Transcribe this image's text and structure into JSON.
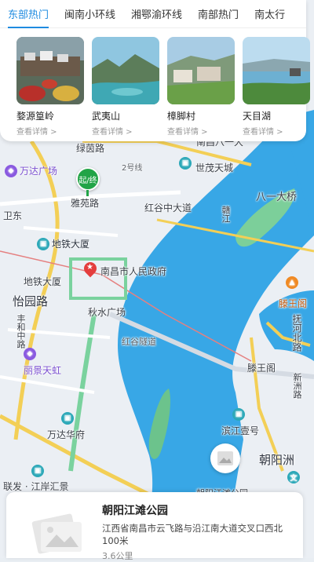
{
  "tabs": [
    {
      "label": "东部热门",
      "active": true
    },
    {
      "label": "闽南小环线",
      "active": false
    },
    {
      "label": "湘鄂渝环线",
      "active": false
    },
    {
      "label": "南部热门",
      "active": false
    },
    {
      "label": "南太行",
      "active": false
    }
  ],
  "cards": [
    {
      "name": "婺源篁岭",
      "more": "查看详情 >"
    },
    {
      "name": "武夷山",
      "more": "查看详情 >"
    },
    {
      "name": "樟脚村",
      "more": "查看详情 >"
    },
    {
      "name": "天目湖",
      "more": "查看详情 >"
    }
  ],
  "map": {
    "labels": {
      "lvyinlu": "绿茵路",
      "nanchangdaqiao": "南昌八一大",
      "line2": "2号线",
      "shimaotiancheng": "世茂天城",
      "bayidaqiao": "八一大桥",
      "wandaguangchang": "万达广场",
      "yaxilu": "雅苑路",
      "weidong": "卫东",
      "honggu": "红谷中大道",
      "ganjiang": "赣江",
      "ditiedasha1": "地铁大厦",
      "gov": "南昌市人民政府",
      "ditiedasha2": "地铁大厦",
      "tengwangge1": "滕王阁",
      "yiyuanlu": "怡园路",
      "qiushui": "秋水广场",
      "fuhebeilu": "抚河北路",
      "fengheluzhong": "丰和中路",
      "hongguzhudao": "红谷隧道",
      "lijingtianhong": "丽景天虹",
      "tengwangge2": "滕王阁",
      "xinzhoulu": "新洲路",
      "wandahuafu": "万达华府",
      "binjiang": "滨江壹号",
      "chaoyangzhou": "朝阳洲",
      "lianfa": "联发 · 江岸汇景",
      "chaoyangpark": "朝阳江滩公园"
    },
    "start_marker": "起/终"
  },
  "bottom_card": {
    "title": "朝阳江滩公园",
    "address": "江西省南昌市云飞路与沿江南大道交叉口西北100米",
    "distance": "3.6公里"
  },
  "colors": {
    "accent": "#1e8be0",
    "water": "#38a7e6",
    "green": "#6cc38c",
    "road_yellow": "#f3cf56",
    "start_marker": "#22a447"
  }
}
